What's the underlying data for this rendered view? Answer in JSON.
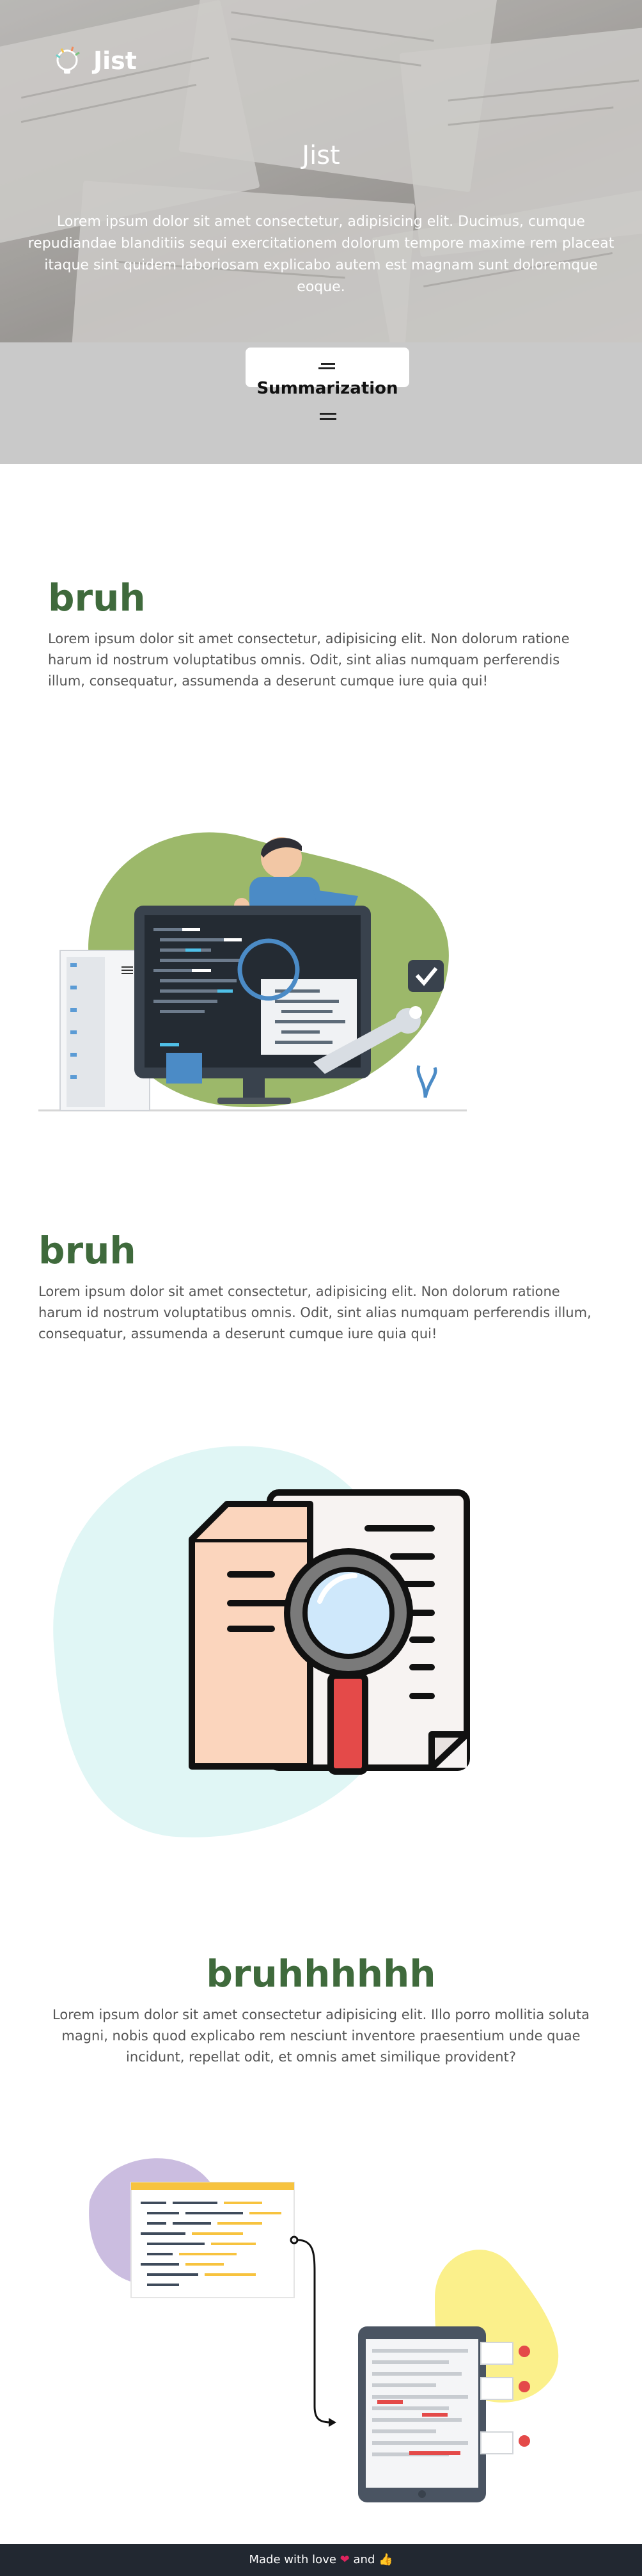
{
  "header": {
    "logo_text": "Jist",
    "title": "Jist",
    "subtitle": "Lorem ipsum dolor sit amet consectetur, adipisicing elit. Ducimus, cumque repudiandae blanditiis sequi exercitationem dolorum tempore maxime rem placeat itaque sint quidem laboriosam explicabo autem est magnam sunt doloremque eoque."
  },
  "tool": {
    "label": "Summarization"
  },
  "sections": [
    {
      "title": "bruh",
      "text": "Lorem ipsum dolor sit amet consectetur, adipisicing elit. Non dolorum ratione harum id nostrum voluptatibus omnis. Odit, sint alias numquam perferendis illum, consequatur, assumenda a deserunt cumque iure quia qui!"
    },
    {
      "title": "bruh",
      "text": "Lorem ipsum dolor sit amet consectetur, adipisicing elit. Non dolorum ratione harum id nostrum voluptatibus omnis. Odit, sint alias numquam perferendis illum, consequatur, assumenda a deserunt cumque iure quia qui!"
    },
    {
      "title": "bruhhhhhh",
      "text": "Lorem ipsum dolor sit amet consectetur adipisicing elit. Illo porro mollitia soluta magni, nobis quod explicabo rem nesciunt inventore praesentium unde quae incidunt, repellat odit, et omnis amet similique provident?"
    }
  ],
  "footer": {
    "prefix": "Made with love",
    "middle": "and",
    "heart_icon": "heart-icon",
    "thumbs_icon": "thumbs-up-icon"
  },
  "colors": {
    "accent_green": "#3f6a3c",
    "footer_bg": "#222831"
  }
}
